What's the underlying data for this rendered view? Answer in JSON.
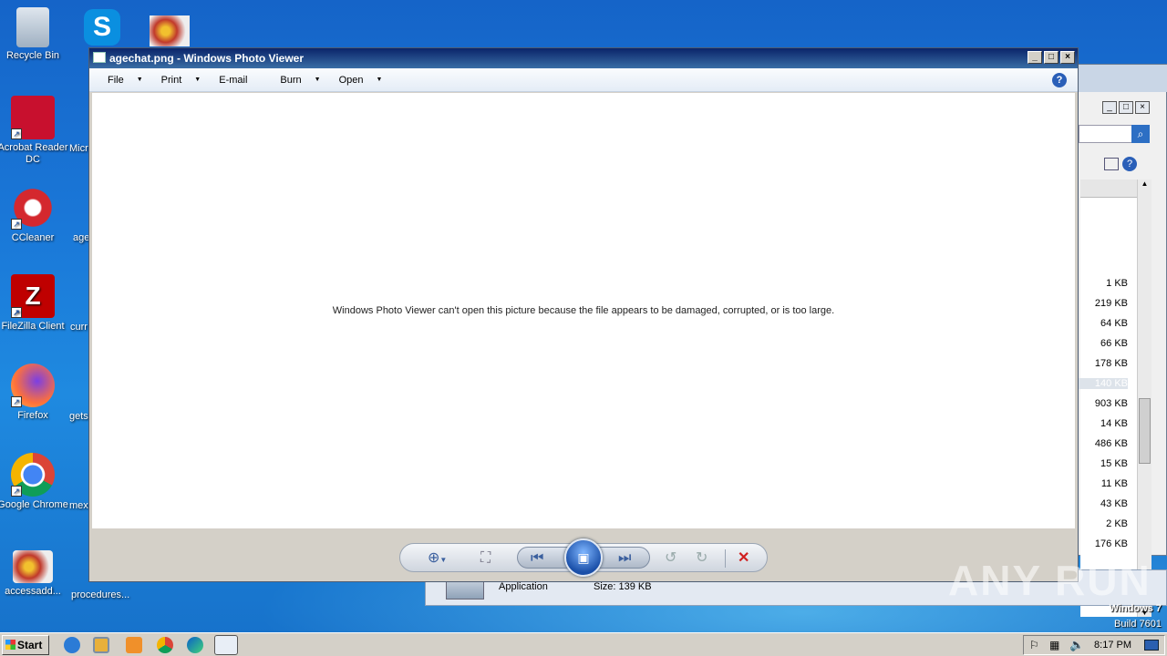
{
  "desktop": {
    "icons": [
      {
        "name": "recycle-bin",
        "label": "Recycle Bin"
      },
      {
        "name": "acrobat",
        "label": "Acrobat Reader DC"
      },
      {
        "name": "ccleaner",
        "label": "CCleaner"
      },
      {
        "name": "filezilla",
        "label": "FileZilla Client"
      },
      {
        "name": "firefox",
        "label": "Firefox"
      },
      {
        "name": "chrome",
        "label": "Google Chrome"
      },
      {
        "name": "accessadd",
        "label": "accessadd..."
      }
    ],
    "partial_labels": [
      "Micr",
      "age",
      "curr",
      "gets",
      "mex",
      "procedures..."
    ]
  },
  "viewer": {
    "title": "agechat.png - Windows Photo Viewer",
    "menu": [
      {
        "label": "File",
        "has_dropdown": true
      },
      {
        "label": "Print",
        "has_dropdown": true
      },
      {
        "label": "E-mail",
        "has_dropdown": false
      },
      {
        "label": "Burn",
        "has_dropdown": true
      },
      {
        "label": "Open",
        "has_dropdown": true
      }
    ],
    "help_glyph": "?",
    "message": "Windows Photo Viewer can't open this picture because the file appears to be damaged, corrupted, or is too large.",
    "controls": {
      "zoom": "zoom-icon",
      "actual_size": "actual-size-icon",
      "previous": "previous-icon",
      "slideshow": "slideshow-icon",
      "next": "next-icon",
      "rotate_ccw": "rotate-ccw-icon",
      "rotate_cw": "rotate-cw-icon",
      "delete": "delete-icon"
    }
  },
  "explorer": {
    "sizes": [
      "1 KB",
      "219 KB",
      "64 KB",
      "66 KB",
      "178 KB",
      "140 KB",
      "903 KB",
      "14 KB",
      "486 KB",
      "15 KB",
      "11 KB",
      "43 KB",
      "2 KB",
      "176 KB"
    ],
    "details": {
      "type": "Application",
      "size": "Size: 139 KB"
    }
  },
  "taskbar": {
    "start_label": "Start",
    "clock": "8:17 PM"
  },
  "os": {
    "name": "Windows 7",
    "build": "Build 7601"
  },
  "watermark": "ANY RUN"
}
